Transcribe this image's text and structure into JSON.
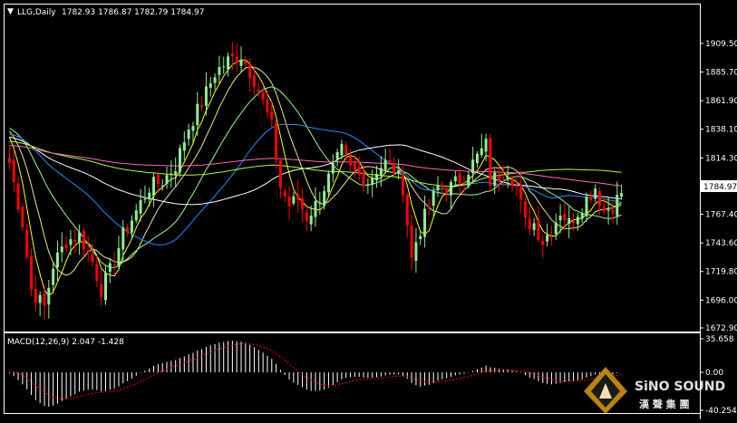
{
  "main_header": {
    "arrow_glyph": "▼",
    "symbol": "LLG,Daily",
    "ohlc": "1782.93 1786.87 1782.79 1784.97"
  },
  "macd_header": {
    "label": "MACD(12,26,9) 2.047 -1.428"
  },
  "current_price_label": "1784.97",
  "logo": {
    "icon": "sino-sound-diamond-logo",
    "text_en": "SiNO SOUND",
    "text_cn": "漢 聲 集 團"
  },
  "colors": {
    "background": "#000000",
    "frame": "#ffffff",
    "bull_candle": "#90ee90",
    "bear_candle": "#ff0000",
    "ma_fast": "#ffff00",
    "ma_2": "#f0e68c",
    "ma_3": "#98fb98",
    "ma_4": "#1e90ff",
    "ma_5": "#ffffff",
    "ma_6": "#adff2f",
    "ma_7": "#ff69b4",
    "macd_hist": "#ffffff",
    "macd_signal": "#ff0000"
  },
  "chart_data": [
    {
      "type": "candlestick",
      "timeframe": "Daily",
      "symbol": "LLG",
      "ylim": [
        1672.9,
        1921.5
      ],
      "y_ticks": [
        "1909.50",
        "1885.70",
        "1861.90",
        "1838.10",
        "1814.30",
        "1791.20",
        "1767.40",
        "1743.60",
        "1719.80",
        "1696.00",
        "1672.90"
      ],
      "last_price": 1784.97,
      "moving_average_count": 7,
      "price_anchors": [
        [
          0,
          1810
        ],
        [
          3,
          1760
        ],
        [
          5,
          1705
        ],
        [
          8,
          1690
        ],
        [
          10,
          1725
        ],
        [
          13,
          1745
        ],
        [
          16,
          1750
        ],
        [
          19,
          1728
        ],
        [
          21,
          1705
        ],
        [
          23,
          1720
        ],
        [
          26,
          1750
        ],
        [
          29,
          1770
        ],
        [
          32,
          1790
        ],
        [
          35,
          1795
        ],
        [
          38,
          1808
        ],
        [
          41,
          1840
        ],
        [
          44,
          1860
        ],
        [
          47,
          1885
        ],
        [
          50,
          1895
        ],
        [
          53,
          1900
        ],
        [
          56,
          1880
        ],
        [
          58,
          1860
        ],
        [
          60,
          1840
        ],
        [
          62,
          1790
        ],
        [
          64,
          1775
        ],
        [
          66,
          1780
        ],
        [
          68,
          1765
        ],
        [
          70,
          1775
        ],
        [
          72,
          1790
        ],
        [
          74,
          1805
        ],
        [
          76,
          1820
        ],
        [
          78,
          1805
        ],
        [
          80,
          1800
        ],
        [
          82,
          1795
        ],
        [
          84,
          1805
        ],
        [
          86,
          1810
        ],
        [
          88,
          1805
        ],
        [
          90,
          1790
        ],
        [
          92,
          1730
        ],
        [
          93,
          1745
        ],
        [
          95,
          1765
        ],
        [
          98,
          1790
        ],
        [
          101,
          1790
        ],
        [
          104,
          1800
        ],
        [
          107,
          1815
        ],
        [
          109,
          1825
        ],
        [
          110,
          1795
        ],
        [
          112,
          1800
        ],
        [
          114,
          1805
        ],
        [
          116,
          1790
        ],
        [
          118,
          1760
        ],
        [
          120,
          1760
        ],
        [
          122,
          1745
        ],
        [
          124,
          1755
        ],
        [
          126,
          1770
        ],
        [
          128,
          1760
        ],
        [
          130,
          1770
        ],
        [
          132,
          1780
        ],
        [
          134,
          1790
        ],
        [
          136,
          1770
        ],
        [
          138,
          1775
        ],
        [
          140,
          1784.97
        ]
      ]
    },
    {
      "type": "macd",
      "params": [
        12,
        26,
        9
      ],
      "macd_value": 2.047,
      "signal_value": -1.428,
      "ylim": [
        -40.254,
        35.658
      ],
      "y_ticks": [
        "35.658",
        "0.00",
        "-40.254"
      ]
    }
  ]
}
